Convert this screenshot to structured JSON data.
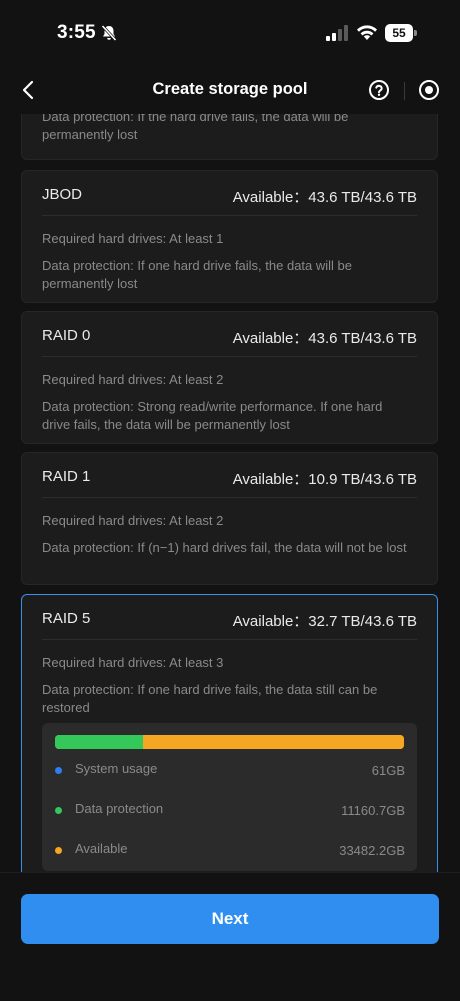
{
  "status_bar": {
    "time": "3:55",
    "battery": "55"
  },
  "header": {
    "title": "Create storage pool"
  },
  "top_card": {
    "protection": "Data protection: If the hard drive fails, the data will be permanently lost"
  },
  "cards": [
    {
      "name": "JBOD",
      "available": "Available：43.6 TB/43.6 TB",
      "required": "Required hard drives: At least 1",
      "protection": "Data protection: If one hard drive fails, the data will be permanently lost"
    },
    {
      "name": "RAID 0",
      "available": "Available：43.6 TB/43.6 TB",
      "required": "Required hard drives: At least 2",
      "protection": "Data protection: Strong read/write performance. If one hard drive fails, the data will be permanently lost"
    },
    {
      "name": "RAID 1",
      "available": "Available：10.9 TB/43.6 TB",
      "required": "Required hard drives: At least 2",
      "protection": "Data protection: If (n−1) hard drives fail, the data will not be lost"
    },
    {
      "name": "RAID 5",
      "available": "Available：32.7 TB/43.6 TB",
      "required": "Required hard drives: At least 3",
      "protection": "Data protection: If one hard drive fails, the data still can be restored",
      "selected": true
    }
  ],
  "usage": {
    "items": [
      {
        "label": "System usage",
        "value": "61GB",
        "amount_gb": 61,
        "color": "#2f7df6"
      },
      {
        "label": "Data protection",
        "value": "11160.7GB",
        "amount_gb": 11160.7,
        "color": "#34c759"
      },
      {
        "label": "Available",
        "value": "33482.2GB",
        "amount_gb": 33482.2,
        "color": "#f5a623"
      }
    ]
  },
  "footer": {
    "next_label": "Next"
  },
  "colors": {
    "accent": "#2f8ef0",
    "selected_border": "#3a8ff0"
  }
}
